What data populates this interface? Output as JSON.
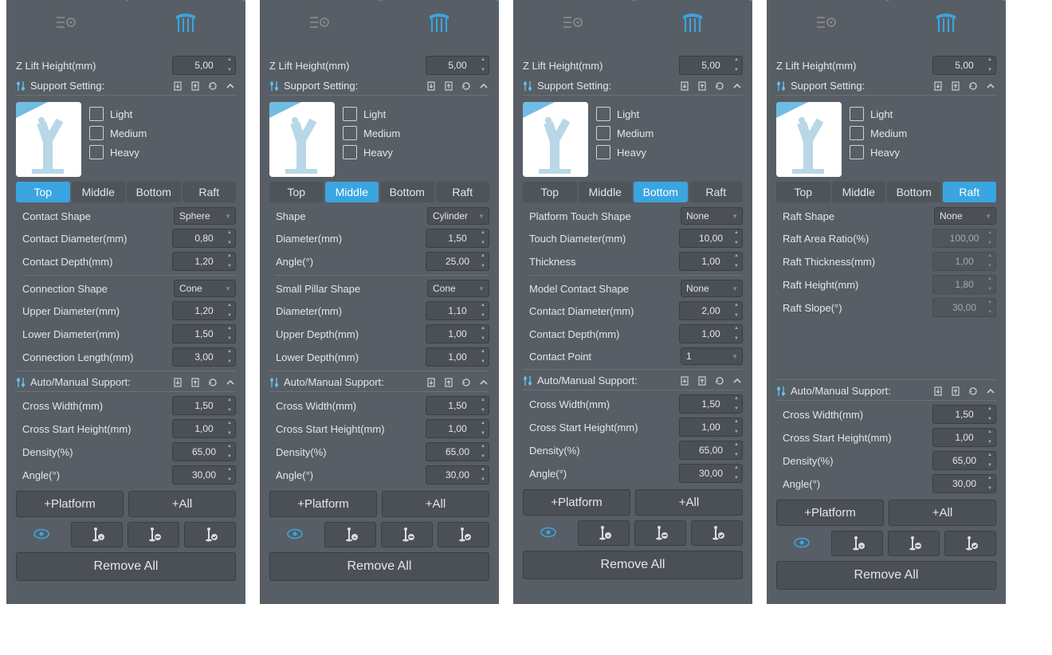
{
  "common": {
    "z_lift_label": "Z Lift Height(mm)",
    "z_lift_value": "5,00",
    "support_setting_label": "Support Setting:",
    "levels": {
      "light": "Light",
      "medium": "Medium",
      "heavy": "Heavy"
    },
    "tabs": {
      "top": "Top",
      "middle": "Middle",
      "bottom": "Bottom",
      "raft": "Raft"
    },
    "auto_manual_label": "Auto/Manual Support:",
    "cross_width_label": "Cross Width(mm)",
    "cross_width_value": "1,50",
    "cross_start_label": "Cross Start Height(mm)",
    "cross_start_value": "1,00",
    "density_label": "Density(%)",
    "density_value": "65,00",
    "angle_label": "Angle(°)",
    "angle_value": "30,00",
    "platform_btn": "+Platform",
    "all_btn": "+All",
    "remove_all": "Remove All"
  },
  "panels": [
    {
      "active_tab": "top",
      "params": [
        {
          "label": "Contact Shape",
          "value": "Sphere",
          "type": "sel"
        },
        {
          "label": "Contact Diameter(mm)",
          "value": "0,80",
          "type": "spin"
        },
        {
          "label": "Contact Depth(mm)",
          "value": "1,20",
          "type": "spin"
        },
        {
          "sep": true
        },
        {
          "label": "Connection Shape",
          "value": "Cone",
          "type": "sel"
        },
        {
          "label": "Upper Diameter(mm)",
          "value": "1,20",
          "type": "spin"
        },
        {
          "label": "Lower Diameter(mm)",
          "value": "1,50",
          "type": "spin"
        },
        {
          "label": "Connection Length(mm)",
          "value": "3,00",
          "type": "spin"
        }
      ]
    },
    {
      "active_tab": "middle",
      "params": [
        {
          "label": "Shape",
          "value": "Cylinder",
          "type": "sel"
        },
        {
          "label": "Diameter(mm)",
          "value": "1,50",
          "type": "spin"
        },
        {
          "label": "Angle(°)",
          "value": "25,00",
          "type": "spin"
        },
        {
          "sep": true
        },
        {
          "label": "Small Pillar Shape",
          "value": "Cone",
          "type": "sel"
        },
        {
          "label": "Diameter(mm)",
          "value": "1,10",
          "type": "spin"
        },
        {
          "label": "Upper Depth(mm)",
          "value": "1,00",
          "type": "spin"
        },
        {
          "label": "Lower Depth(mm)",
          "value": "1,00",
          "type": "spin"
        }
      ]
    },
    {
      "active_tab": "bottom",
      "params": [
        {
          "label": "Platform Touch Shape",
          "value": "None",
          "type": "sel"
        },
        {
          "label": "Touch Diameter(mm)",
          "value": "10,00",
          "type": "spin"
        },
        {
          "label": "Thickness",
          "value": "1,00",
          "type": "spin"
        },
        {
          "sep": true
        },
        {
          "label": "Model Contact Shape",
          "value": "None",
          "type": "sel"
        },
        {
          "label": "Contact Diameter(mm)",
          "value": "2,00",
          "type": "spin"
        },
        {
          "label": "Contact Depth(mm)",
          "value": "1,00",
          "type": "spin"
        },
        {
          "label": "Contact Point",
          "value": "1",
          "type": "sel"
        }
      ]
    },
    {
      "active_tab": "raft",
      "params": [
        {
          "label": "Raft Shape",
          "value": "None",
          "type": "sel"
        },
        {
          "label": "Raft Area Ratio(%)",
          "value": "100,00",
          "type": "spin",
          "dis": true
        },
        {
          "label": "Raft Thickness(mm)",
          "value": "1,00",
          "type": "spin",
          "dis": true
        },
        {
          "label": "Raft Height(mm)",
          "value": "1,80",
          "type": "spin",
          "dis": true
        },
        {
          "label": "Raft Slope(°)",
          "value": "30,00",
          "type": "spin",
          "dis": true
        }
      ],
      "autoGap": true
    }
  ]
}
